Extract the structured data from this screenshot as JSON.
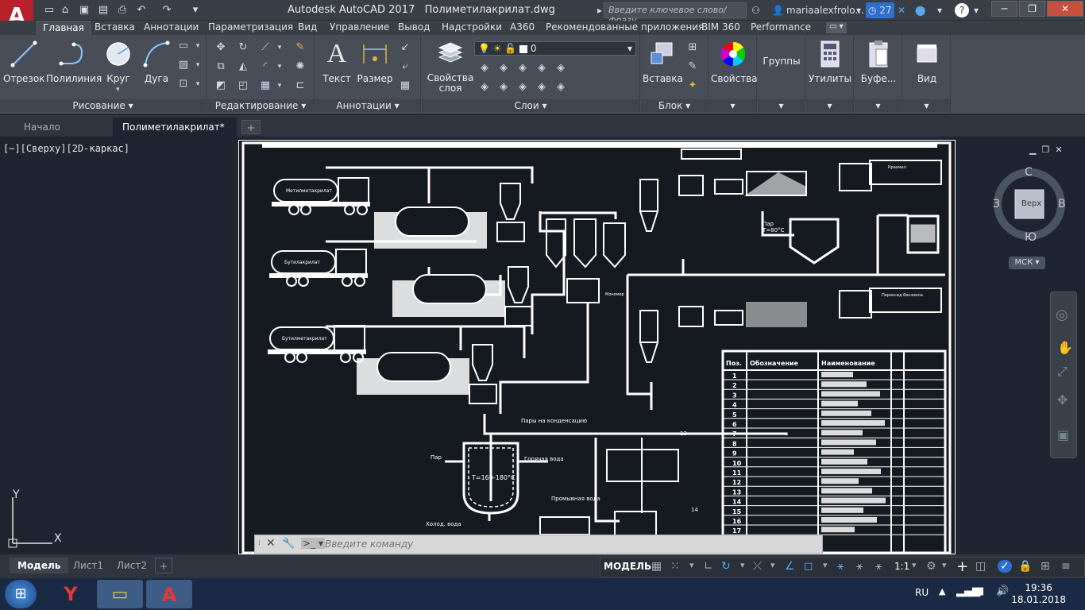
{
  "app": {
    "title": "Autodesk AutoCAD 2017",
    "filename": "Полиметилакрилат.dwg",
    "logo_letter": "A"
  },
  "search": {
    "placeholder": "Введите ключевое слово/фразу"
  },
  "user": {
    "name": "mariaalexfrolo...",
    "badge": "27"
  },
  "ribbon_tabs": [
    "Главная",
    "Вставка",
    "Аннотации",
    "Параметризация",
    "Вид",
    "Управление",
    "Вывод",
    "Надстройки",
    "A360",
    "Рекомендованные приложения",
    "BIM 360",
    "Performance"
  ],
  "panels": {
    "draw": {
      "title": "Рисование",
      "buttons": [
        "Отрезок",
        "Полилиния",
        "Круг",
        "Дуга"
      ]
    },
    "modify": {
      "title": "Редактирование"
    },
    "annot": {
      "title": "Аннотации",
      "buttons": [
        "Текст",
        "Размер"
      ]
    },
    "layers": {
      "title": "Слои",
      "button": "Свойства слоя",
      "layer_value": "0"
    },
    "block": {
      "title": "Блок",
      "button": "Вставка"
    },
    "props": {
      "button": "Свойства"
    },
    "groups": {
      "button": "Группы"
    },
    "utils": {
      "button": "Утилиты"
    },
    "clip": {
      "button": "Буфе..."
    },
    "view": {
      "button": "Вид"
    }
  },
  "doc_tabs": [
    "Начало",
    "Полиметилакрилат*"
  ],
  "viewport_label": "[−][Сверху][2D-каркас]",
  "viewcube": {
    "n": "С",
    "s": "Ю",
    "w": "З",
    "e": "В",
    "face": "Верх",
    "ucs": "МСК"
  },
  "axes": {
    "x": "X",
    "y": "Y"
  },
  "command": {
    "placeholder": "Введите команду"
  },
  "layout_tabs": [
    "Модель",
    "Лист1",
    "Лист2"
  ],
  "status": {
    "model": "МОДЕЛЬ",
    "scale": "1:1"
  },
  "tray": {
    "lang": "RU",
    "time": "19:36",
    "date": "18.01.2018"
  },
  "drawing": {
    "trucks": [
      "Метилметакрилат",
      "Бутилакрилат",
      "Бутилметакрилат"
    ],
    "truck_right": [
      "Крахмал",
      "Пероксид бензоила"
    ],
    "labels": {
      "steam": "Пар",
      "temp1": "T=80°C",
      "vapor": "Пары на конденсацию",
      "hot_water": "Горячая вода",
      "cold_water": "Холод. вода",
      "reactor_temp": "T=160-180°C",
      "wash_water": "Промывная вода",
      "monomer": "Мономер"
    },
    "numbers": [
      "1",
      "2",
      "3",
      "4",
      "5",
      "6",
      "7",
      "8",
      "9",
      "10",
      "11",
      "12",
      "13",
      "14",
      "15",
      "16",
      "17"
    ],
    "table_headers": [
      "Поз.",
      "Обозначение",
      "Наименование"
    ]
  }
}
